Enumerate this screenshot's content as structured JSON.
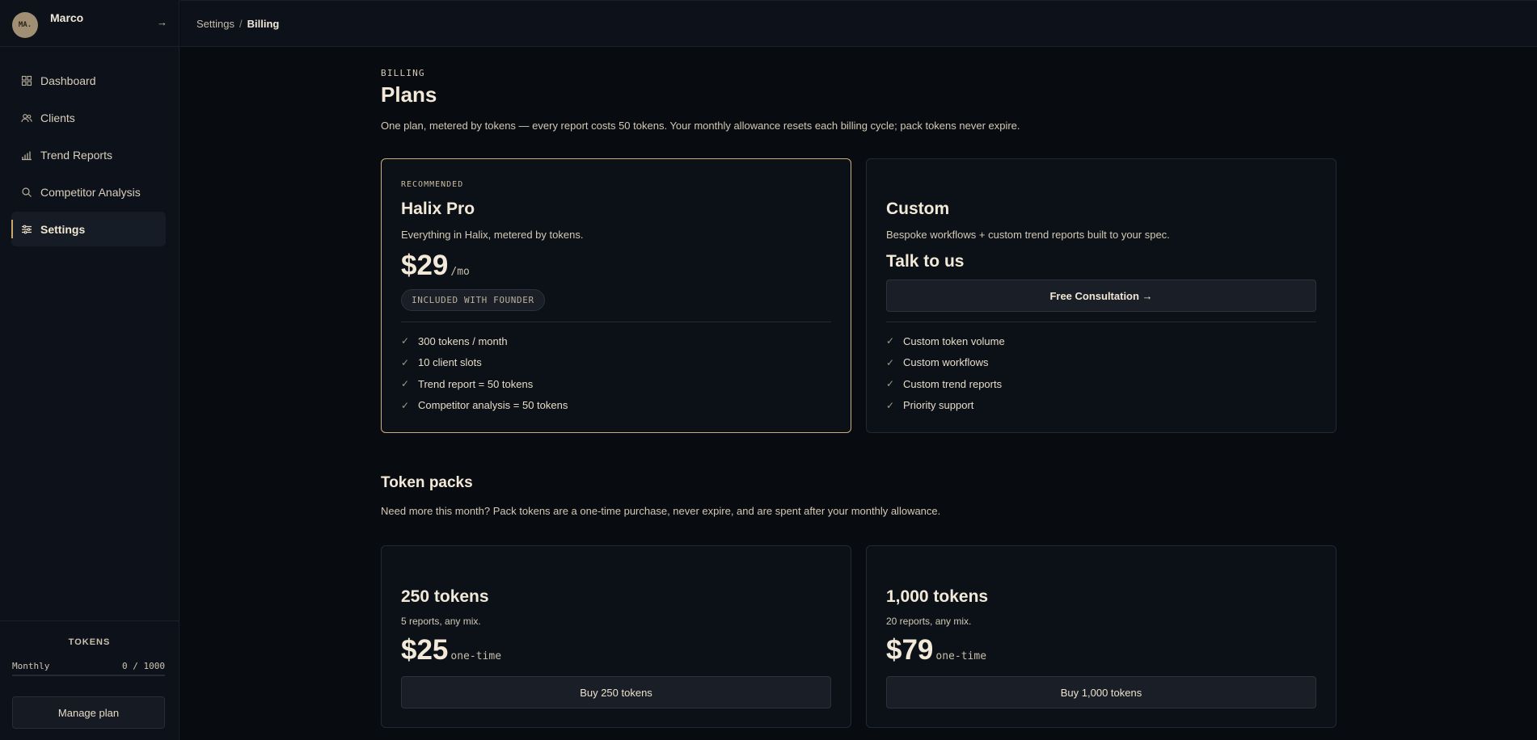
{
  "user": {
    "initials": "MA",
    "name": "Marco",
    "logout_icon": "→"
  },
  "sidebar": {
    "items": [
      {
        "label": "Dashboard",
        "icon": "grid-icon"
      },
      {
        "label": "Clients",
        "icon": "users-icon"
      },
      {
        "label": "Trend Reports",
        "icon": "bar-chart-icon"
      },
      {
        "label": "Competitor Analysis",
        "icon": "search-icon"
      },
      {
        "label": "Settings",
        "icon": "sliders-icon",
        "active": true
      }
    ],
    "tokens": {
      "title": "TOKENS",
      "label": "Monthly",
      "value": "0 / 1000",
      "used_fraction": 0
    },
    "manage_label": "Manage plan"
  },
  "breadcrumb": {
    "parent": "Settings",
    "separator": "/",
    "current": "Billing"
  },
  "page": {
    "eyebrow": "BILLING",
    "title": "Plans",
    "lead": "One plan, metered by tokens — every report costs 50 tokens. Your monthly allowance resets each billing cycle; pack tokens never expire."
  },
  "plans": {
    "pro": {
      "eyebrow": "RECOMMENDED",
      "name": "Halix Pro",
      "desc": "Everything in Halix, metered by tokens.",
      "price": "$29",
      "unit": "/mo",
      "badge": "INCLUDED WITH FOUNDER",
      "features": [
        "300 tokens / month",
        "10 client slots",
        "Trend report = 50 tokens",
        "Competitor analysis = 50 tokens"
      ]
    },
    "custom": {
      "name": "Custom",
      "desc": "Bespoke workflows + custom trend reports built to your spec.",
      "headline": "Talk to us",
      "cta": "Free Consultation →",
      "features": [
        "Custom token volume",
        "Custom workflows",
        "Custom trend reports",
        "Priority support"
      ]
    }
  },
  "packs": {
    "title": "Token packs",
    "lead": "Need more this month? Pack tokens are a one-time purchase, never expire, and are spent after your monthly allowance.",
    "items": [
      {
        "name": "250 tokens",
        "desc": "5 reports, any mix.",
        "price": "$25",
        "unit": "one-time",
        "cta": "Buy 250 tokens"
      },
      {
        "name": "1,000 tokens",
        "desc": "20 reports, any mix.",
        "price": "$79",
        "unit": "one-time",
        "cta": "Buy 1,000 tokens"
      }
    ]
  },
  "check_glyph": "✓"
}
